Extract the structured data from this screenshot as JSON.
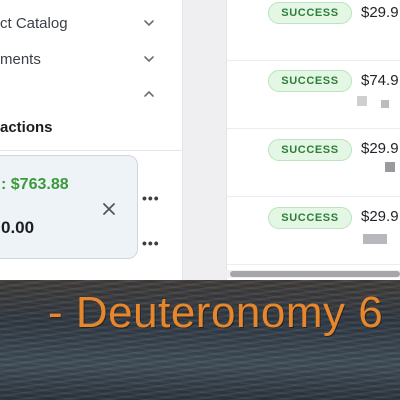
{
  "sidebar": {
    "items": [
      {
        "label": "ct Catalog",
        "expanded": false
      },
      {
        "label": "ments",
        "expanded": false
      },
      {
        "label": "",
        "expanded": true
      }
    ],
    "section_title": "actions",
    "transaction_card": {
      "amount_text": ": $763.88",
      "total_text": "0.00"
    },
    "more_icon": "more-dots-icon",
    "close_icon": "close-icon"
  },
  "main": {
    "rows": [
      {
        "status": "SUCCESS",
        "price": "$29.9"
      },
      {
        "status": "SUCCESS",
        "price": "$74.9"
      },
      {
        "status": "SUCCESS",
        "price": "$29.9"
      },
      {
        "status": "SUCCESS",
        "price": "$29.9"
      }
    ]
  },
  "wallpaper": {
    "verse_text": "- Deuteronomy 6"
  },
  "colors": {
    "success_badge_bg": "#e4f7e4",
    "success_text": "#2d7e3a",
    "amount_green": "#3a9a3a",
    "verse_orange": "#e7862a"
  }
}
